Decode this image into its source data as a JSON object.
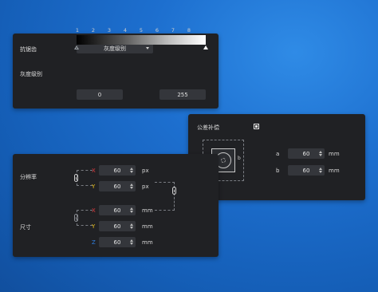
{
  "antialias": {
    "label": "抗锯齿",
    "select_value": "灰度级别",
    "gray_label": "灰度级别",
    "ticks": [
      "1",
      "2",
      "3",
      "4",
      "5",
      "6",
      "7",
      "8"
    ],
    "min_value": "0",
    "max_value": "255"
  },
  "tolerance": {
    "title": "公差补偿",
    "diagram_a": "a",
    "diagram_b": "b",
    "a_label": "a",
    "a_value": "60",
    "b_label": "b",
    "b_value": "60",
    "unit": "mm"
  },
  "dimensions": {
    "resolution_label": "分辨率",
    "size_label": "尺寸",
    "rows": [
      {
        "axis": "X",
        "value": "60",
        "unit": "px"
      },
      {
        "axis": "Y",
        "value": "60",
        "unit": "px"
      },
      {
        "axis": "X",
        "value": "60",
        "unit": "mm"
      },
      {
        "axis": "Y",
        "value": "60",
        "unit": "mm"
      },
      {
        "axis": "Z",
        "value": "60",
        "unit": "mm"
      }
    ]
  },
  "colors": {
    "x": "#e0393e",
    "y": "#f0c419",
    "z": "#2f7fe0"
  }
}
